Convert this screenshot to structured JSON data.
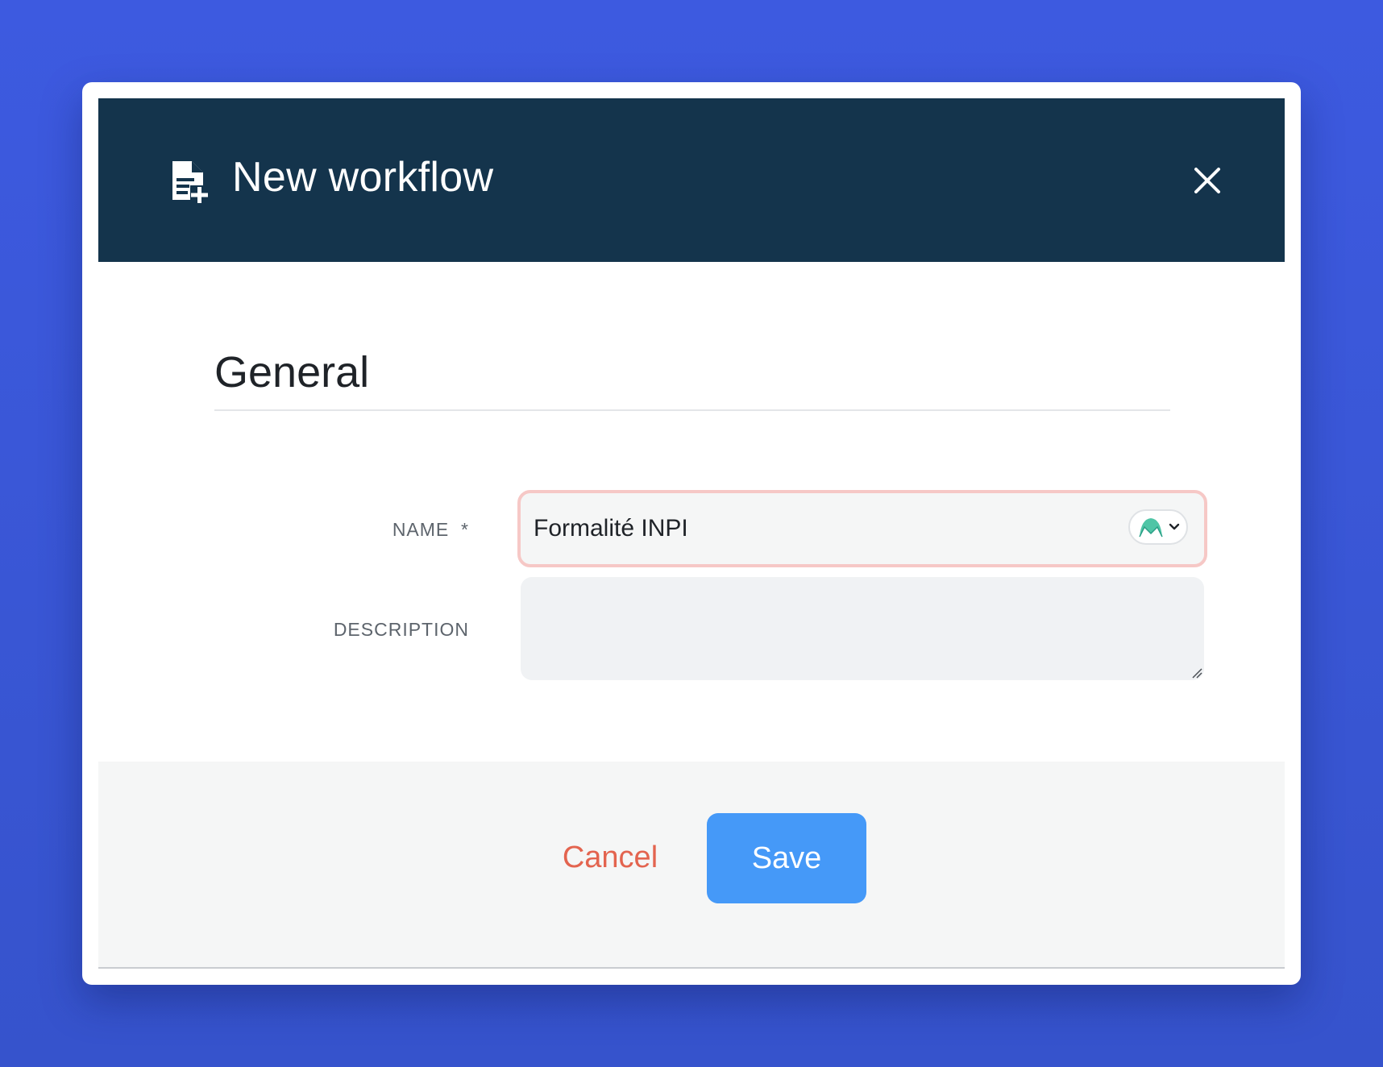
{
  "modal": {
    "title": "New workflow",
    "header_icon": "file-add-icon",
    "close_icon": "close-icon"
  },
  "section": {
    "title": "General"
  },
  "fields": {
    "name": {
      "label": "NAME  *",
      "value": "Formalité INPI",
      "language_icon": "language-flag-icon"
    },
    "description": {
      "label": "DESCRIPTION",
      "value": ""
    }
  },
  "footer": {
    "cancel_label": "Cancel",
    "save_label": "Save"
  },
  "colors": {
    "background": "#3d5ae0",
    "header": "#14344c",
    "cancel": "#e3644f",
    "save": "#4599f8",
    "error_border": "#f6c8c6"
  }
}
